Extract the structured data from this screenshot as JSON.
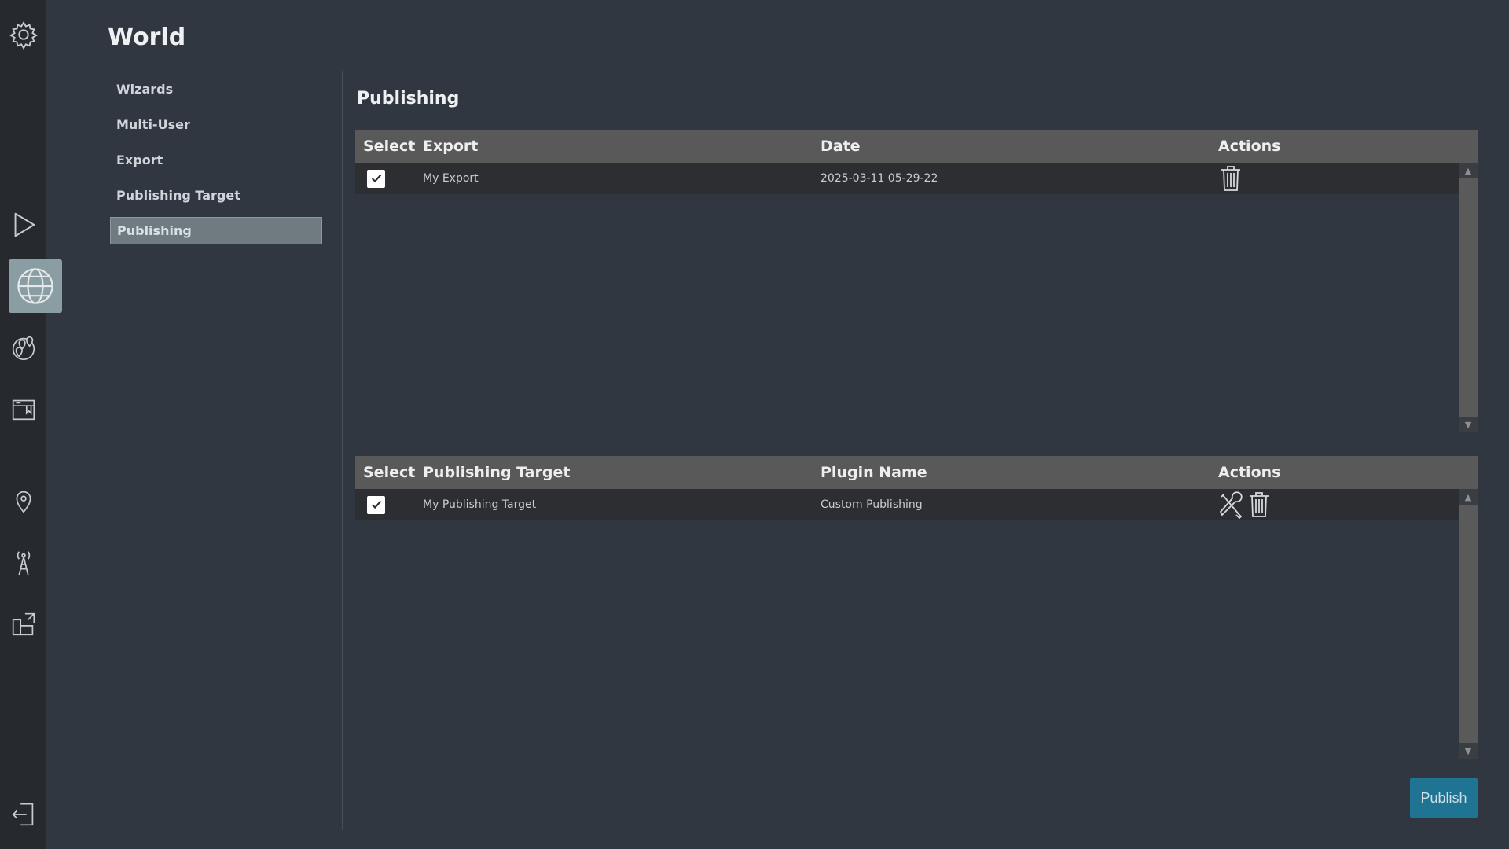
{
  "page": {
    "title": "World"
  },
  "rail": {
    "icons": [
      "gear-icon",
      "play-icon",
      "globe-icon",
      "map-pins-icon",
      "folder-icon",
      "location-pin-icon",
      "antenna-tower-icon",
      "plugin-icon",
      "logout-icon"
    ]
  },
  "subnav": {
    "items": [
      {
        "label": "Wizards"
      },
      {
        "label": "Multi-User"
      },
      {
        "label": "Export"
      },
      {
        "label": "Publishing Target"
      },
      {
        "label": "Publishing"
      }
    ],
    "active_label": "Publishing"
  },
  "section": {
    "title": "Publishing"
  },
  "exports_table": {
    "headers": {
      "select": "Select",
      "col2": "Export",
      "col3": "Date",
      "actions": "Actions"
    },
    "rows": [
      {
        "checked": true,
        "name": "My Export",
        "date": "2025-03-11 05-29-22"
      }
    ]
  },
  "targets_table": {
    "headers": {
      "select": "Select",
      "col2": "Publishing Target",
      "col3": "Plugin Name",
      "actions": "Actions"
    },
    "rows": [
      {
        "checked": true,
        "name": "My Publishing Target",
        "plugin": "Custom Publishing"
      }
    ]
  },
  "actions": {
    "publish_label": "Publish"
  },
  "colors": {
    "accent": "#1f7393",
    "rail_bg": "#262a2f",
    "page_bg": "#303741",
    "header_bg": "#595959"
  }
}
